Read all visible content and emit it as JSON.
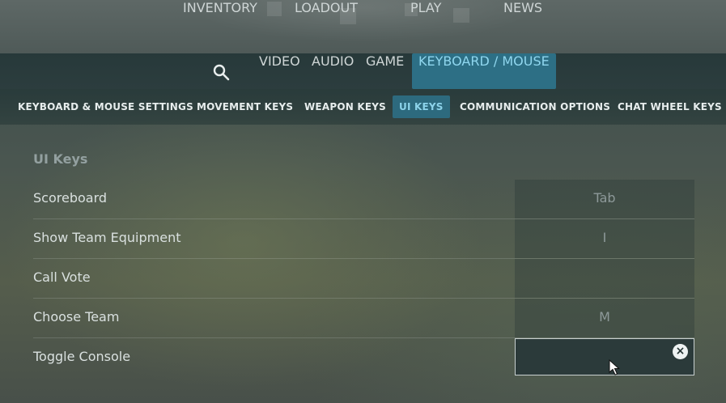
{
  "topnav": {
    "items": [
      "INVENTORY",
      "LOADOUT",
      "PLAY",
      "NEWS"
    ]
  },
  "settings_tabs": {
    "search_icon": "search-icon",
    "items": [
      "VIDEO",
      "AUDIO",
      "GAME",
      "KEYBOARD / MOUSE"
    ],
    "active": "KEYBOARD / MOUSE"
  },
  "subtabs": {
    "items": [
      "KEYBOARD & MOUSE SETTINGS",
      "MOVEMENT KEYS",
      "WEAPON KEYS",
      "UI KEYS",
      "COMMUNICATION OPTIONS",
      "CHAT WHEEL KEYS"
    ],
    "active": "UI KEYS"
  },
  "section": {
    "title": "UI Keys",
    "rows": [
      {
        "label": "Scoreboard",
        "key": "Tab"
      },
      {
        "label": "Show Team Equipment",
        "key": "I"
      },
      {
        "label": "Call Vote",
        "key": ""
      },
      {
        "label": "Choose Team",
        "key": "M"
      },
      {
        "label": "Toggle Console",
        "key": ""
      }
    ]
  },
  "bind_box": {
    "clear_glyph": "×"
  },
  "colors": {
    "accent_bg": "#2d6f85",
    "accent_text": "#8fd6ee"
  }
}
